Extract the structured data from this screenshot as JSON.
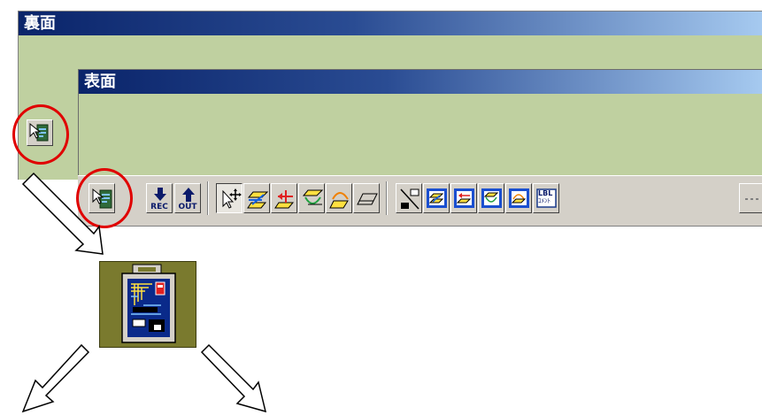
{
  "windows": {
    "back_title": "裏面",
    "front_title": "表面"
  },
  "toolbar": {
    "buttons": [
      {
        "name": "board-layout-button",
        "icon": "board-icon"
      },
      {
        "name": "rec-button",
        "icon": "arrow-down-icon",
        "caption": "REC"
      },
      {
        "name": "out-button",
        "icon": "arrow-up-icon",
        "caption": "OUT"
      },
      {
        "name": "select-move-button",
        "icon": "select-move-icon",
        "selected": true
      },
      {
        "name": "tool-blue-button",
        "icon": "yellow-layer-blue-arrow-icon"
      },
      {
        "name": "tool-red-button",
        "icon": "yellow-layer-red-arrow-icon"
      },
      {
        "name": "tool-green-button",
        "icon": "yellow-layer-green-arc-icon"
      },
      {
        "name": "tool-orange-button",
        "icon": "yellow-layer-orange-arc-icon"
      },
      {
        "name": "tool-plain-button",
        "icon": "layer-parallelogram-icon"
      },
      {
        "name": "component-delete-button",
        "icon": "component-delete-icon"
      },
      {
        "name": "framed-blue-button",
        "icon": "framed-blue-arrow-icon"
      },
      {
        "name": "framed-red-button",
        "icon": "framed-red-arrow-icon"
      },
      {
        "name": "framed-green-button",
        "icon": "framed-green-arc-icon"
      },
      {
        "name": "framed-orange-button",
        "icon": "framed-orange-arc-icon"
      },
      {
        "name": "label-comment-button",
        "icon": "lbl-comment-icon",
        "label_top": "LBL",
        "label_bottom": "ｺﾒﾝﾄ"
      }
    ]
  },
  "colors": {
    "window_bg": "#bfd0a0",
    "title_start": "#0a246a",
    "title_end": "#a6caf0",
    "highlight_ring": "#e00000",
    "toolbar_bg": "#d4d0c8"
  }
}
